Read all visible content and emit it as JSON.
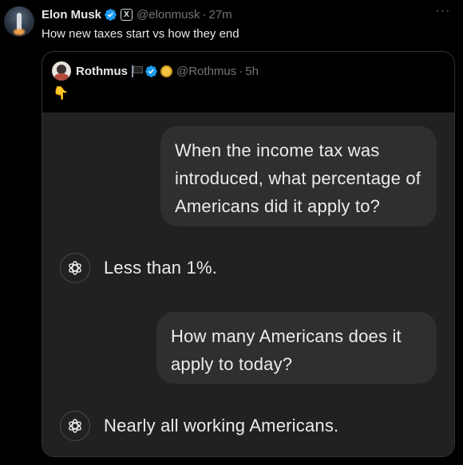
{
  "post": {
    "author_name": "Elon Musk",
    "affiliation_badge": "X",
    "handle": "@elonmusk",
    "separator": "·",
    "time": "27m",
    "more_label": "···",
    "text": "How new taxes start vs how they end"
  },
  "quote": {
    "author_name": "Rothmus",
    "handle": "@Rothmus",
    "separator": "·",
    "time": "5h",
    "emoji": "👇",
    "chat": {
      "user_message_1": "When the income tax was introduced, what percentage of Americans did it apply to?",
      "assistant_reply_1": "Less than 1%.",
      "user_message_2": "How many Americans does it apply to today?",
      "assistant_reply_2": "Nearly all working Americans."
    }
  },
  "colors": {
    "background": "#000000",
    "text_primary": "#e7e9ea",
    "text_secondary": "#71767b",
    "verified_blue": "#1d9bf0",
    "border": "#2f3336",
    "chat_background": "#212121",
    "bubble_background": "#2f2f2f"
  },
  "icons": {
    "verified": "verified-badge-icon",
    "more": "more-horizontal-icon",
    "assistant": "openai-logo-icon"
  }
}
